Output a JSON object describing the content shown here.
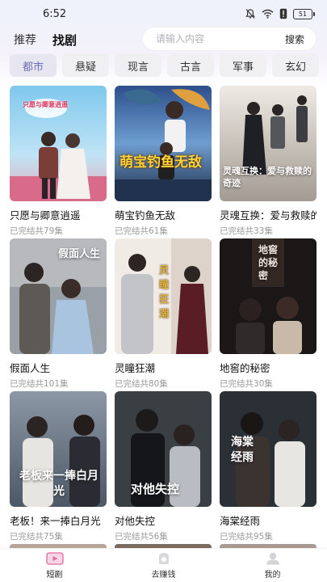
{
  "status_bar": {
    "time": "6:52",
    "battery": "51"
  },
  "header": {
    "tabs": [
      {
        "label": "推荐",
        "active": false
      },
      {
        "label": "找剧",
        "active": true
      }
    ],
    "search": {
      "placeholder": "请输入内容",
      "button_label": "搜索"
    }
  },
  "categories": [
    "都市",
    "悬疑",
    "现言",
    "古言",
    "军事",
    "玄幻"
  ],
  "active_category": "都市",
  "dramas": [
    {
      "title": "只愿与卿意逍遥",
      "status": "已完结共79集"
    },
    {
      "title": "萌宝钓鱼无敌",
      "status": "已完结共61集"
    },
    {
      "title": "灵魂互换：爱与救赎的奇迹",
      "status": "已完结共33集"
    },
    {
      "title": "假面人生",
      "status": "已完结共101集"
    },
    {
      "title": "灵瞳狂潮",
      "status": "已完结共80集"
    },
    {
      "title": "地窖的秘密",
      "status": "已完结共30集"
    },
    {
      "title": "老板！来一捧白月光",
      "status": "已完结共75集"
    },
    {
      "title": "对他失控",
      "status": "已完结共56集"
    },
    {
      "title": "海棠经雨",
      "status": "已完结共95集"
    }
  ],
  "posters": [
    {
      "caption": "只愿与卿意逍遥"
    },
    {
      "caption": "萌宝钓鱼无敌"
    },
    {
      "caption": "灵魂互换：爱与救赎的奇迹"
    },
    {
      "caption": "假面人生"
    },
    {
      "caption": "灵瞳狂潮"
    },
    {
      "caption": "地窖的秘密"
    },
    {
      "caption": "老板来一捧白月光"
    },
    {
      "caption": "对他失控"
    },
    {
      "caption": "海棠经雨"
    }
  ],
  "bottom_nav": [
    {
      "label": "短剧",
      "icon": "short-drama-icon",
      "active": true
    },
    {
      "label": "去赚钱",
      "icon": "earn-money-icon",
      "active": false
    },
    {
      "label": "我的",
      "icon": "profile-icon",
      "active": false
    }
  ]
}
